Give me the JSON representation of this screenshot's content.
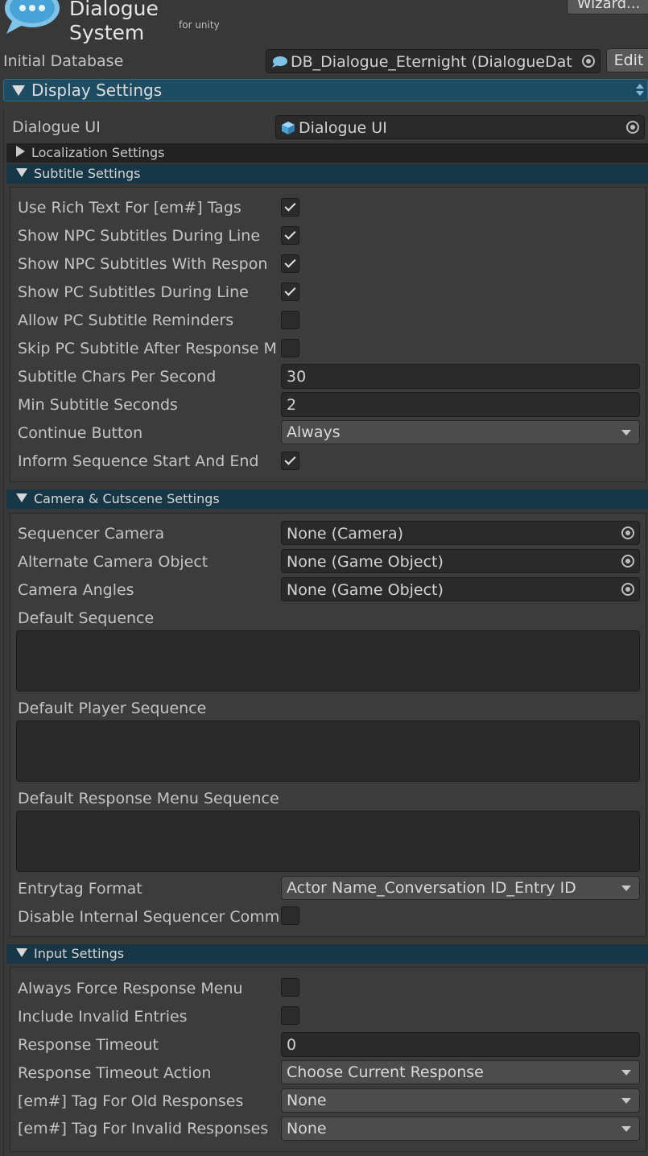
{
  "header": {
    "logo_title": "Dialogue System",
    "logo_subtitle": "for unity",
    "wizard_button": "Wizard..."
  },
  "initial_database": {
    "label": "Initial Database",
    "value": "DB_Dialogue_Eternight (DialogueDat",
    "edit_button": "Edit"
  },
  "display_settings": {
    "title": "Display Settings",
    "dialogue_ui_label": "Dialogue UI",
    "dialogue_ui_value": "Dialogue UI",
    "localization_title": "Localization Settings"
  },
  "subtitle_settings": {
    "title": "Subtitle Settings",
    "rows": [
      {
        "label": "Use Rich Text For [em#] Tags",
        "checked": true
      },
      {
        "label": "Show NPC Subtitles During Line",
        "checked": true
      },
      {
        "label": "Show NPC Subtitles With Respon",
        "checked": true
      },
      {
        "label": "Show PC Subtitles During Line",
        "checked": true
      },
      {
        "label": "Allow PC Subtitle Reminders",
        "checked": false
      },
      {
        "label": "Skip PC Subtitle After Response M",
        "checked": false
      }
    ],
    "chars_per_second_label": "Subtitle Chars Per Second",
    "chars_per_second_value": "30",
    "min_seconds_label": "Min Subtitle Seconds",
    "min_seconds_value": "2",
    "continue_button_label": "Continue Button",
    "continue_button_value": "Always",
    "inform_sequence_label": "Inform Sequence Start And End",
    "inform_sequence_checked": true
  },
  "camera_settings": {
    "title": "Camera & Cutscene Settings",
    "sequencer_camera_label": "Sequencer Camera",
    "sequencer_camera_value": "None (Camera)",
    "alternate_camera_label": "Alternate Camera Object",
    "alternate_camera_value": "None (Game Object)",
    "camera_angles_label": "Camera Angles",
    "camera_angles_value": "None (Game Object)",
    "default_sequence_label": "Default Sequence",
    "default_player_sequence_label": "Default Player Sequence",
    "default_response_menu_sequence_label": "Default Response Menu Sequence",
    "entrytag_format_label": "Entrytag Format",
    "entrytag_format_value": "Actor Name_Conversation ID_Entry ID",
    "disable_internal_label": "Disable Internal Sequencer Comm",
    "disable_internal_checked": false
  },
  "input_settings": {
    "title": "Input Settings",
    "always_force_label": "Always Force Response Menu",
    "always_force_checked": false,
    "include_invalid_label": "Include Invalid Entries",
    "include_invalid_checked": false,
    "response_timeout_label": "Response Timeout",
    "response_timeout_value": "0",
    "timeout_action_label": "Response Timeout Action",
    "timeout_action_value": "Choose Current Response",
    "old_responses_label": "[em#] Tag For Old Responses",
    "old_responses_value": "None",
    "invalid_responses_label": "[em#] Tag For Invalid Responses",
    "invalid_responses_value": "None"
  }
}
